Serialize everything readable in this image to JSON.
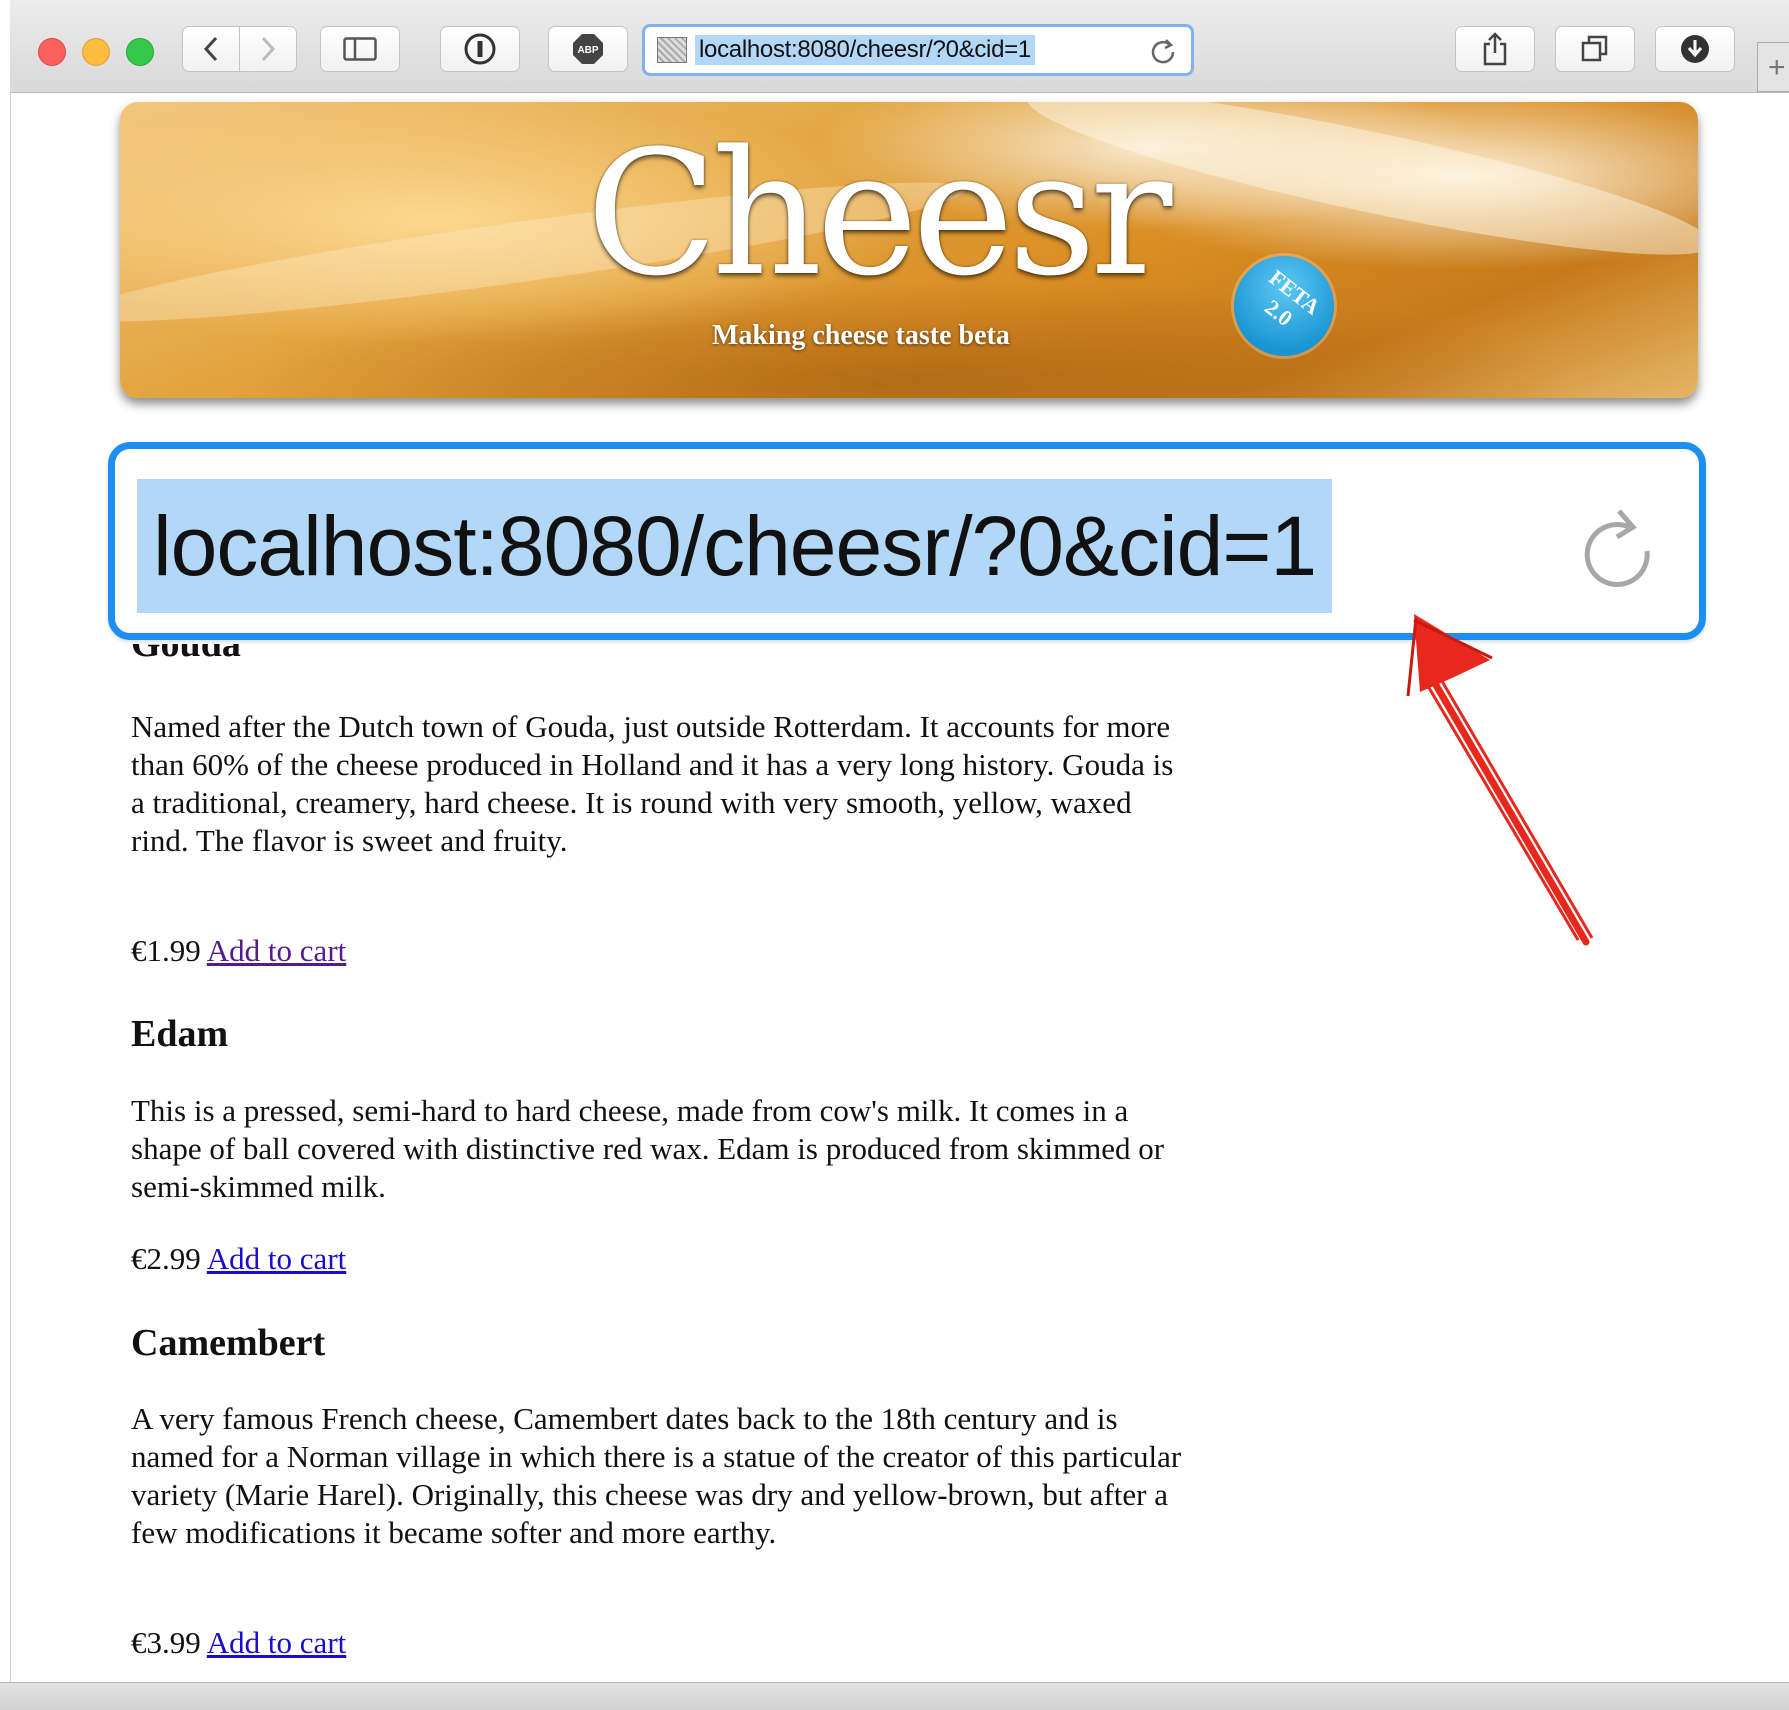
{
  "browser": {
    "url": "localhost:8080/cheesr/?0&cid=1",
    "new_tab": "+"
  },
  "banner": {
    "logo": "Cheesr",
    "tagline": "Making cheese taste beta",
    "badge_line1": "FETA",
    "badge_line2": "2.0"
  },
  "callout": {
    "url": "localhost:8080/cheesr/?0&cid=1",
    "arrow_color": "#e8281c",
    "border_color": "#1e8ff2"
  },
  "cheeses": [
    {
      "name": "Gouda",
      "description": "Named after the Dutch town of Gouda, just outside Rotterdam. It accounts for more than 60% of the cheese produced in Holland and it has a very long history. Gouda is a traditional, creamery, hard cheese. It is round with very smooth, yellow, waxed rind. The flavor is sweet and fruity.",
      "price": "€1.99",
      "add_label": "Add to cart"
    },
    {
      "name": "Edam",
      "description": "This is a pressed, semi-hard to hard cheese, made from cow's milk. It comes in a shape of ball covered with distinctive red wax. Edam is produced from skimmed or semi-skimmed milk.",
      "price": "€2.99",
      "add_label": "Add to cart"
    },
    {
      "name": "Camembert",
      "description": "A very famous French cheese, Camembert dates back to the 18th century and is named for a Norman village in which there is a statue of the creator of this particular variety (Marie Harel). Originally, this cheese was dry and yellow-brown, but after a few modifications it became softer and more earthy.",
      "price": "€3.99",
      "add_label": "Add to cart"
    }
  ],
  "icons": {
    "back": "chevron-left-icon",
    "forward": "chevron-right-icon",
    "sidebar": "sidebar-icon",
    "reader": "info-icon",
    "adblock": "abp-icon",
    "share": "share-icon",
    "tabs": "tabs-icon",
    "downloads": "download-icon",
    "reload": "reload-icon"
  }
}
